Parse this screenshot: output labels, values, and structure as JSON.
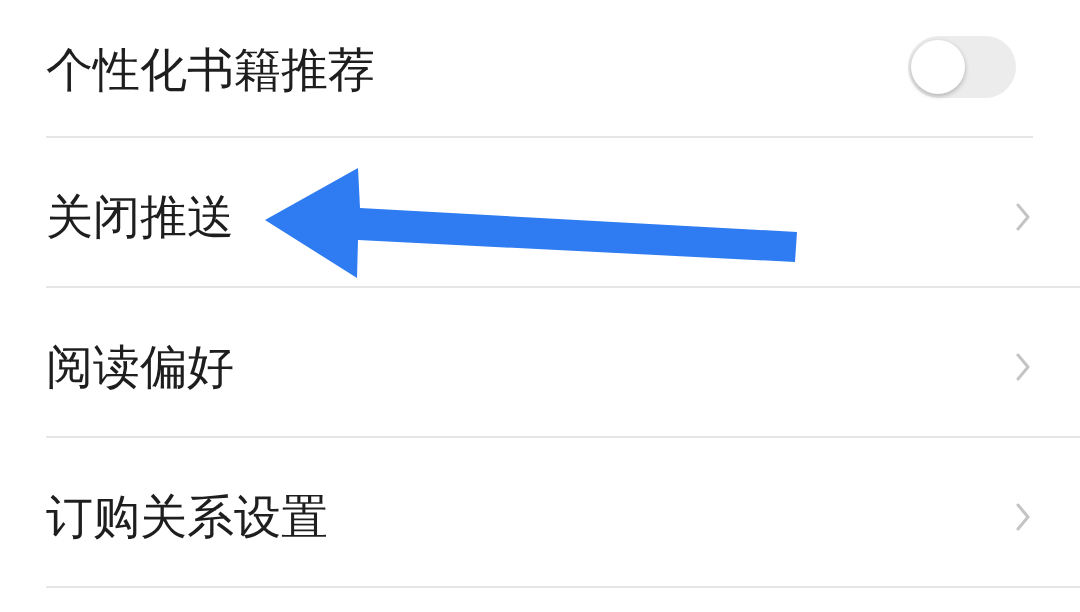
{
  "settings": [
    {
      "kind": "toggle",
      "label": "个性化书籍推荐",
      "on": false
    },
    {
      "kind": "link",
      "label": "关闭推送"
    },
    {
      "kind": "link",
      "label": "阅读偏好"
    },
    {
      "kind": "link",
      "label": "订购关系设置"
    }
  ]
}
